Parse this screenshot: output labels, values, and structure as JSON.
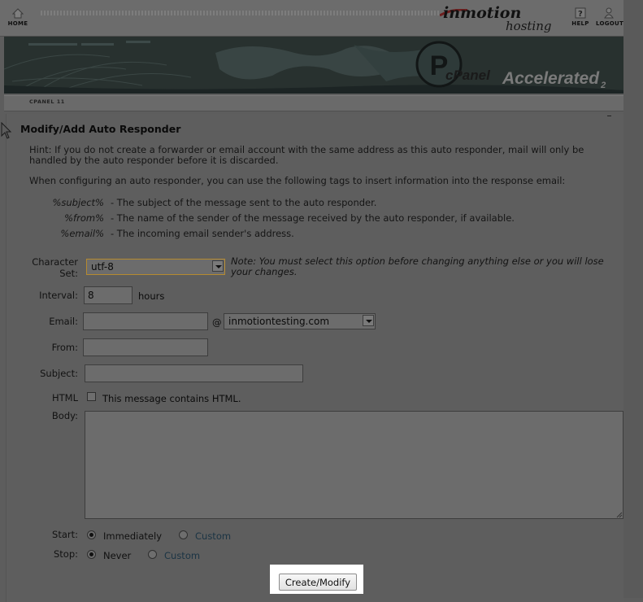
{
  "header": {
    "home_label": "HOME",
    "help_label": "HELP",
    "logout_label": "LOGOUT",
    "brand_inmotion": "inmotion",
    "brand_hosting": "hosting"
  },
  "banner": {
    "cpanel_text": "cPanel",
    "accelerated_text": "Accelerated",
    "accelerated_version": "2"
  },
  "breadcrumb": "CPANEL 11",
  "page": {
    "title": "Modify/Add Auto Responder",
    "hint": "Hint: If you do not create a forwarder or email account with the same address as this auto responder, mail will only be handled by the auto responder before it is discarded.",
    "tags_intro": "When configuring an auto responder, you can use the following tags to insert information into the response email:",
    "tags": [
      {
        "tag": "%subject%",
        "desc": "-  The subject of the message sent to the auto responder."
      },
      {
        "tag": "%from%",
        "desc": "-  The name of the sender of the message received by the auto responder, if available."
      },
      {
        "tag": "%email%",
        "desc": "-  The incoming email sender's address."
      }
    ]
  },
  "form": {
    "charset_label_1": "Character",
    "charset_label_2": "Set:",
    "charset_value": "utf-8",
    "charset_note": "Note: You must select this option before changing anything else or you will lose your changes.",
    "interval_label": "Interval:",
    "interval_value": "8",
    "interval_unit": "hours",
    "email_label": "Email:",
    "email_value": "",
    "at_sign": "@",
    "domain_value": "inmotiontesting.com",
    "from_label": "From:",
    "from_value": "",
    "subject_label": "Subject:",
    "subject_value": "",
    "html_label": "HTML",
    "html_checkbox_label": "This message contains HTML.",
    "html_checked": false,
    "body_label": "Body:",
    "body_value": "",
    "start_label": "Start:",
    "start_options": [
      "Immediately",
      "Custom"
    ],
    "start_selected": "Immediately",
    "stop_label": "Stop:",
    "stop_options": [
      "Never",
      "Custom"
    ],
    "stop_selected": "Never",
    "submit_label": "Create/Modify"
  },
  "icons": [
    "home-icon",
    "help-icon",
    "logout-icon",
    "cpanel-logo-icon",
    "mouse-cursor-icon"
  ],
  "colors": {
    "dimmed_background": "#5d5d5d",
    "highlight": "#ffffff",
    "brand_red": "#8a1c1c"
  }
}
